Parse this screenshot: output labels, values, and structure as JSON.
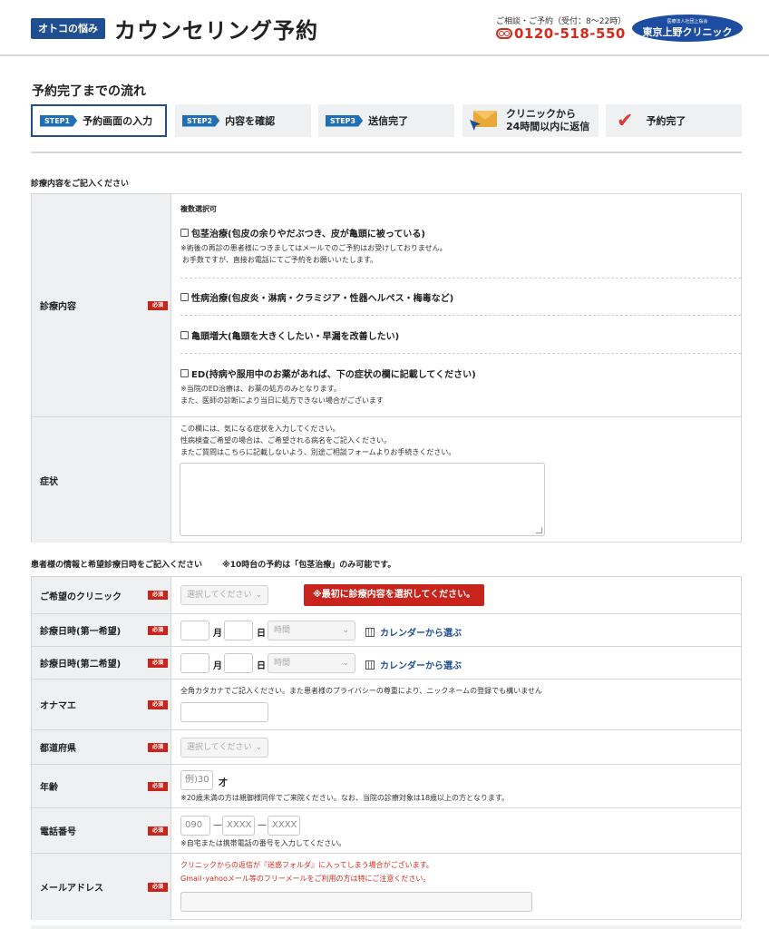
{
  "header": {
    "brand_badge": "オトコの悩み",
    "title": "カウンセリング予約",
    "contact_label": "ご相談・ご予約（受付：8～22時）",
    "phone": "0120-518-550",
    "clinic_sub": "医療法人社団上桜会",
    "clinic_name": "東京上野クリニック"
  },
  "flow": {
    "title": "予約完了までの流れ",
    "steps": [
      {
        "tag": "STEP1",
        "label": "予約画面の入力"
      },
      {
        "tag": "STEP2",
        "label": "内容を確認"
      },
      {
        "tag": "STEP3",
        "label": "送信完了"
      },
      {
        "line1": "クリニックから",
        "line2": "24時間以内に返信"
      },
      {
        "label": "予約完了"
      }
    ]
  },
  "section1": {
    "label": "診療内容をご記入ください",
    "treatment": {
      "label": "診療内容",
      "required": "必須",
      "multi": "複数選択可",
      "options": [
        {
          "label": "包茎治療(包皮の余りやだぶつき、皮が亀頭に被っている)",
          "note1": "※術後の再診の患者様につきましてはメールでのご予約はお受けしておりません。",
          "note2": "お手数ですが、直接お電話にてご予約をお願いいたします。"
        },
        {
          "label": "性病治療(包皮炎・淋病・クラミジア・性器ヘルペス・梅毒など)"
        },
        {
          "label": "亀頭増大(亀頭を大きくしたい・早漏を改善したい)"
        },
        {
          "label": "ED(持病や服用中のお薬があれば、下の症状の欄に記載してください)",
          "note1": "※当院のED治療は、お薬の処方のみとなります。",
          "note2": "また、医師の診断により当日に処方できない場合がございます"
        }
      ]
    },
    "symptoms": {
      "label": "症状",
      "help1": "この欄には、気になる症状を入力してください。",
      "help2": "性病検査ご希望の場合は、ご希望される病名をご記入ください。",
      "help3": "またご質問はこちらに記載しないよう、別途ご相談フォームよりお手続きください。"
    }
  },
  "section2": {
    "label": "患者様の情報と希望診療日時をご記入ください",
    "note": "※10時台の予約は「包茎治療」のみ可能です。",
    "clinic": {
      "label": "ご希望のクリニック",
      "required": "必須",
      "select": "選択してください",
      "alert": "※最初に診療内容を選択してください。"
    },
    "date1": {
      "label": "診療日時(第一希望)",
      "required": "必須",
      "month": "月",
      "day": "日",
      "time": "時間",
      "calendar": "カレンダーから選ぶ"
    },
    "date2": {
      "label": "診療日時(第二希望)",
      "required": "必須",
      "month": "月",
      "day": "日",
      "time": "時間",
      "calendar": "カレンダーから選ぶ"
    },
    "name": {
      "label": "オナマエ",
      "required": "必須",
      "help": "全角カタカナでご記入ください。また患者様のプライバシーの尊重により、ニックネームの登録でも構いません"
    },
    "prefecture": {
      "label": "都道府県",
      "required": "必須",
      "select": "選択してください"
    },
    "age": {
      "label": "年齢",
      "required": "必須",
      "placeholder": "例)30",
      "unit": "才",
      "note": "※20歳未満の方は親御様同伴でご来院ください。なお、当院の診療対象は18歳以上の方となります。"
    },
    "phone": {
      "label": "電話番号",
      "required": "必須",
      "p1": "090",
      "p2": "XXXX",
      "p3": "XXXX",
      "dash": "—",
      "note": "※自宅または携帯電話の番号を入力してください。"
    },
    "email": {
      "label": "メールアドレス",
      "required": "必須",
      "note1": "クリニックからの返信が『迷惑フォルダ』に入ってしまう場合がございます。",
      "note2": "Gmail･yahooメール等のフリーメールをご利用の方は特にご注意ください。"
    }
  }
}
